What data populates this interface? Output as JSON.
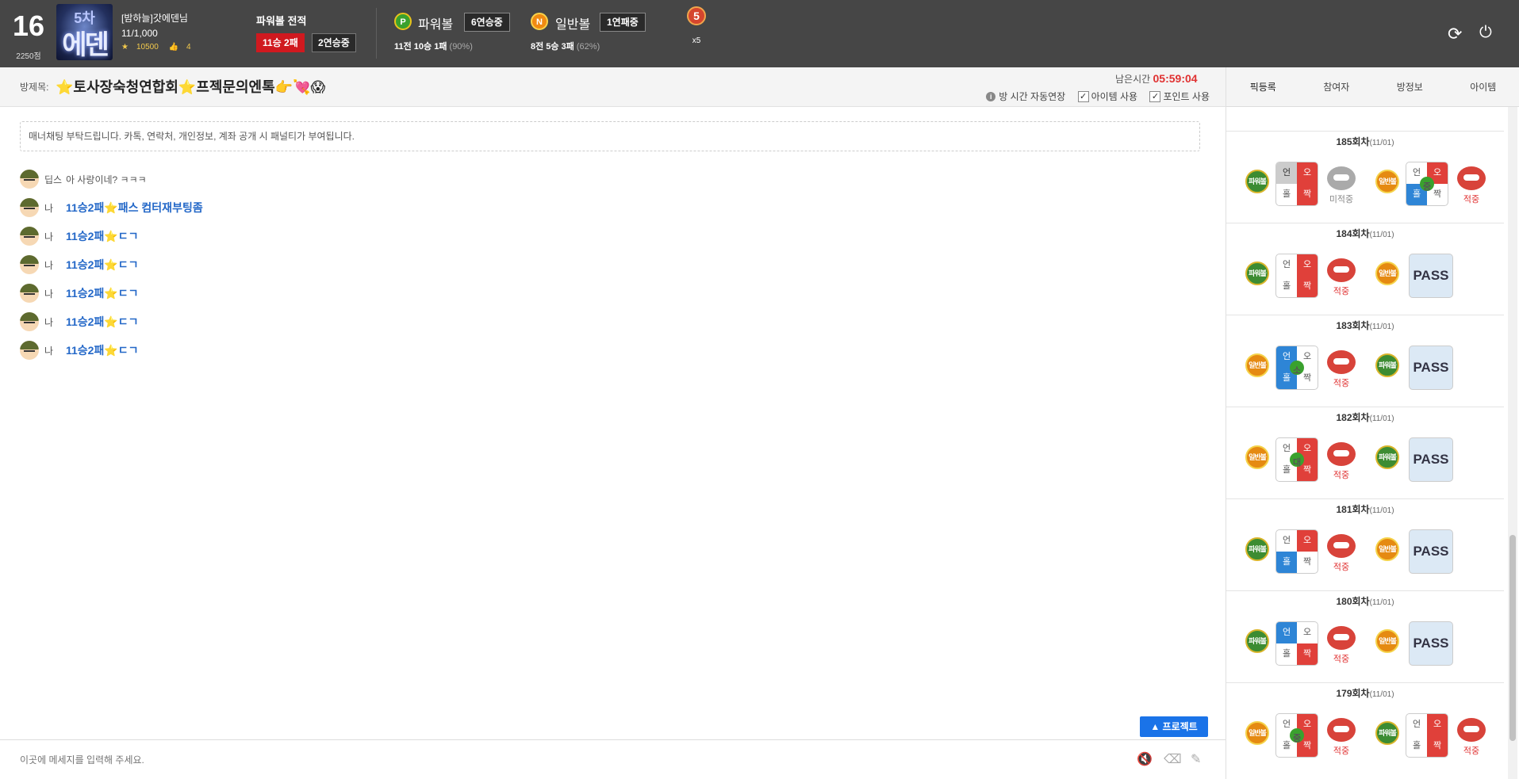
{
  "header": {
    "level": "16",
    "points": "2250점",
    "avatar_text_1": "5차",
    "avatar_text_2": "에덴",
    "username": "[밤하늘]갓에덴님",
    "user_progress": "11/1,000",
    "coins": "10500",
    "likes": "4",
    "record_title": "파워볼 전적",
    "record_badge": "11승 2패",
    "record_streak": "2연승중",
    "powerball": {
      "ball": "P",
      "name": "파워볼",
      "streak": "6연승중",
      "summary_main": "11전 10승 1패",
      "summary_pct": "(90%)"
    },
    "normalball": {
      "ball": "N",
      "name": "일반볼",
      "streak": "1연패중",
      "summary_main": "8전 5승 3패",
      "summary_pct": "(62%)"
    },
    "medal": "5",
    "medal_mult": "x5",
    "icons": {
      "refresh": "refresh-icon",
      "power": "power-icon"
    }
  },
  "room": {
    "label": "방제목:",
    "title": "⭐토사장숙청연합회⭐프젝문의엔톡👉💘😱",
    "timer_label": "남은시간",
    "timer_value": "05:59:04",
    "auto_extend": "방 시간 자동연장",
    "item_use": "아이템 사용",
    "point_use": "포인트 사용"
  },
  "chat": {
    "notice": "매너채팅 부탁드립니다. 카톡, 연락처, 개인정보, 계좌 공개 시 패널티가 부여됩니다.",
    "messages": [
      {
        "who": "딥스",
        "text": "아 사랑이네? ㅋㅋㅋ",
        "mine": false
      },
      {
        "who": "나",
        "text": "11승2패⭐패스 컴터재부팅좀",
        "mine": true
      },
      {
        "who": "나",
        "text": "11승2패⭐ㄷㄱ",
        "mine": true
      },
      {
        "who": "나",
        "text": "11승2패⭐ㄷㄱ",
        "mine": true
      },
      {
        "who": "나",
        "text": "11승2패⭐ㄷㄱ",
        "mine": true
      },
      {
        "who": "나",
        "text": "11승2패⭐ㄷㄱ",
        "mine": true
      },
      {
        "who": "나",
        "text": "11승2패⭐ㄷㄱ",
        "mine": true
      }
    ],
    "protect_button": "▲ 프로젝트",
    "input_placeholder": "이곳에 메세지를 입력해 주세요."
  },
  "right_tabs": [
    "픽등록",
    "참여자",
    "방정보",
    "아이템"
  ],
  "rounds": [
    {
      "title": "185회차",
      "date": "(11/01)",
      "picks": [
        {
          "game": "파워볼",
          "grid": [
            "언",
            "오",
            "홀",
            "짝"
          ],
          "hl": [
            "g",
            "r",
            "",
            "r"
          ],
          "mid": "",
          "result": "미적중"
        },
        {
          "game": "일반볼",
          "grid": [
            "언",
            "오",
            "홀",
            "짝"
          ],
          "hl": [
            "",
            "r",
            "b",
            ""
          ],
          "mid": "중",
          "result": "적중"
        }
      ]
    },
    {
      "title": "184회차",
      "date": "(11/01)",
      "picks": [
        {
          "game": "파워볼",
          "grid": [
            "언",
            "오",
            "홀",
            "짝"
          ],
          "hl": [
            "",
            "r",
            "",
            "r"
          ],
          "mid": "",
          "result": "적중"
        },
        {
          "game": "일반볼",
          "pass": "PASS"
        }
      ]
    },
    {
      "title": "183회차",
      "date": "(11/01)",
      "picks": [
        {
          "game": "일반볼",
          "grid": [
            "언",
            "오",
            "홀",
            "짝"
          ],
          "hl": [
            "b",
            "",
            "b",
            ""
          ],
          "mid": "소",
          "result": "적중"
        },
        {
          "game": "파워볼",
          "pass": "PASS"
        }
      ]
    },
    {
      "title": "182회차",
      "date": "(11/01)",
      "picks": [
        {
          "game": "일반볼",
          "grid": [
            "언",
            "오",
            "홀",
            "짝"
          ],
          "hl": [
            "",
            "r",
            "",
            "r"
          ],
          "mid": "대",
          "result": "적중"
        },
        {
          "game": "파워볼",
          "pass": "PASS"
        }
      ]
    },
    {
      "title": "181회차",
      "date": "(11/01)",
      "picks": [
        {
          "game": "파워볼",
          "grid": [
            "언",
            "오",
            "홀",
            "짝"
          ],
          "hl": [
            "",
            "r",
            "b",
            ""
          ],
          "mid": "",
          "result": "적중"
        },
        {
          "game": "일반볼",
          "pass": "PASS"
        }
      ]
    },
    {
      "title": "180회차",
      "date": "(11/01)",
      "picks": [
        {
          "game": "파워볼",
          "grid": [
            "언",
            "오",
            "홀",
            "짝"
          ],
          "hl": [
            "b",
            "",
            "",
            "r"
          ],
          "mid": "",
          "result": "적중"
        },
        {
          "game": "일반볼",
          "pass": "PASS"
        }
      ]
    },
    {
      "title": "179회차",
      "date": "(11/01)",
      "picks": [
        {
          "game": "일반볼",
          "grid": [
            "언",
            "오",
            "홀",
            "짝"
          ],
          "hl": [
            "",
            "r",
            "",
            "r"
          ],
          "mid": "중",
          "result": "적중"
        },
        {
          "game": "파워볼",
          "grid": [
            "언",
            "오",
            "홀",
            "짝"
          ],
          "hl": [
            "",
            "r",
            "",
            "r"
          ],
          "mid": "",
          "result": "적중"
        }
      ]
    }
  ],
  "colors": {
    "accent_blue": "#1a73e8",
    "win_red": "#e03131",
    "header_bg": "#464646"
  }
}
